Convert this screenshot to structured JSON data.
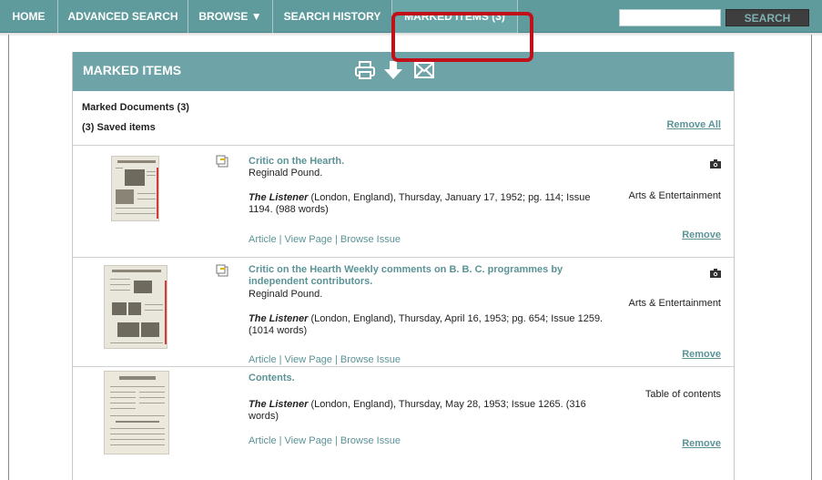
{
  "nav": {
    "items": [
      {
        "label": "HOME"
      },
      {
        "label": "ADVANCED SEARCH"
      },
      {
        "label": "BROWSE ▼"
      },
      {
        "label": "SEARCH HISTORY"
      },
      {
        "label": "MARKED ITEMS (3)"
      }
    ],
    "search_value": "",
    "search_button": "SEARCH"
  },
  "panel": {
    "title": "MARKED ITEMS",
    "marked_documents": "Marked Documents (3)",
    "saved_items": "(3) Saved items",
    "remove_all": "Remove All"
  },
  "results": [
    {
      "title": "Critic on the Hearth.",
      "author": "Reginald Pound.",
      "publication": "The Listener",
      "citation": " (London, England),  Thursday,  January 17, 1952; pg. 114; Issue 1194.  (988 words)",
      "category": "Arts & Entertainment",
      "links": [
        "Article",
        "View Page",
        "Browse Issue"
      ],
      "remove": "Remove"
    },
    {
      "title": "Critic on the Hearth Weekly comments on B. B. C. programmes by independent contributors.",
      "author": "Reginald Pound.",
      "publication": "The Listener",
      "citation": " (London, England),  Thursday,  April 16, 1953; pg. 654; Issue 1259.  (1014 words)",
      "category": "Arts & Entertainment",
      "links": [
        "Article",
        "View Page",
        "Browse Issue"
      ],
      "remove": "Remove"
    },
    {
      "title": "Contents.",
      "author": "",
      "publication": "The Listener",
      "citation": " (London, England),  Thursday,  May 28, 1953; Issue 1265.  (316 words)",
      "category": "Table of contents",
      "links": [
        "Article",
        "View Page",
        "Browse Issue"
      ],
      "remove": "Remove"
    }
  ],
  "colors": {
    "nav_bg": "#5f9a9d",
    "panel_header": "#6ea4a7",
    "link": "#5b9396",
    "highlight": "#c0111b"
  },
  "icons": [
    "print-icon",
    "download-icon",
    "email-icon",
    "note-icon",
    "camera-icon"
  ]
}
